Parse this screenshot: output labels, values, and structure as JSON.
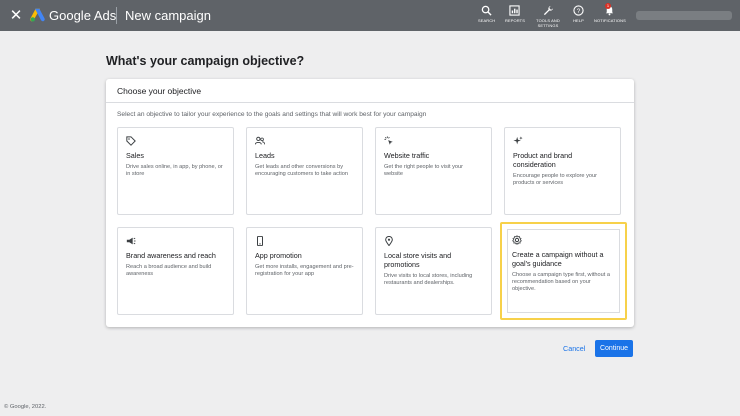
{
  "header": {
    "close_icon": "close-icon",
    "brand": "Google Ads",
    "page_title": "New campaign",
    "tools": [
      {
        "label": "SEARCH",
        "icon": "search-icon"
      },
      {
        "label": "REPORTS",
        "icon": "reports-icon"
      },
      {
        "label": "TOOLS AND SETTINGS",
        "icon": "wrench-icon"
      },
      {
        "label": "HELP",
        "icon": "help-icon"
      },
      {
        "label": "NOTIFICATIONS",
        "icon": "bell-icon",
        "badge": "1"
      }
    ]
  },
  "main": {
    "heading": "What's your campaign objective?",
    "card_title": "Choose your objective",
    "card_description": "Select an objective to tailor your experience to the goals and settings that will work best for your campaign",
    "objectives": [
      {
        "title": "Sales",
        "description": "Drive sales online, in app, by phone, or in store",
        "icon": "tag-icon"
      },
      {
        "title": "Leads",
        "description": "Get leads and other conversions by encouraging customers to take action",
        "icon": "people-icon"
      },
      {
        "title": "Website traffic",
        "description": "Get the right people to visit your website",
        "icon": "cursor-click-icon"
      },
      {
        "title": "Product and brand consideration",
        "description": "Encourage people to explore your products or services",
        "icon": "sparkle-icon"
      },
      {
        "title": "Brand awareness and reach",
        "description": "Reach a broad audience and build awareness",
        "icon": "megaphone-icon"
      },
      {
        "title": "App promotion",
        "description": "Get more installs, engagement and pre-registration for your app",
        "icon": "phone-icon"
      },
      {
        "title": "Local store visits and promotions",
        "description": "Drive visits to local stores, including restaurants and dealerships.",
        "icon": "location-pin-icon"
      },
      {
        "title": "Create a campaign without a goal's guidance",
        "description": "Choose a campaign type first, without a recommendation based on your objective.",
        "icon": "settings-gear-icon",
        "selected": true
      }
    ],
    "cancel_label": "Cancel",
    "continue_label": "Continue"
  },
  "footer": {
    "copyright": "© Google, 2022."
  },
  "colors": {
    "topbar": "#5f6368",
    "accent": "#1a73e8",
    "highlight": "#f7d14a",
    "background": "#eeeeef"
  }
}
